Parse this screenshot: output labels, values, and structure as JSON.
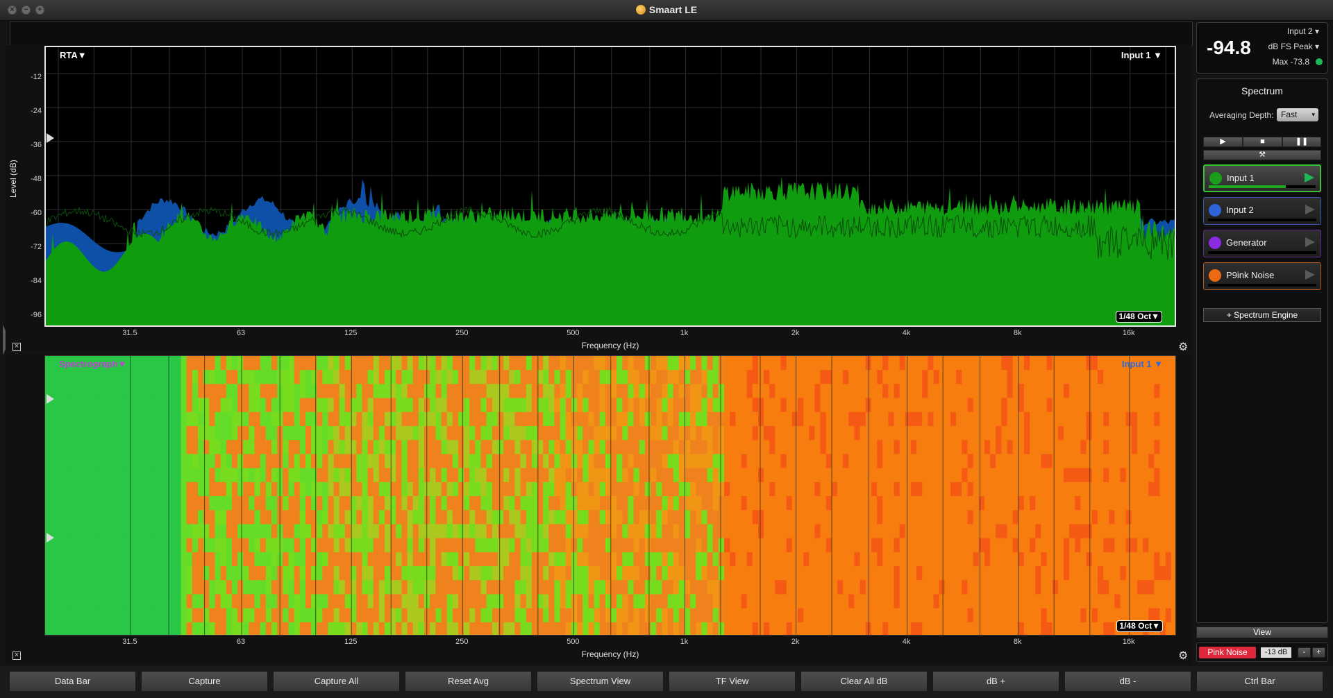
{
  "window": {
    "title": "Smaart LE"
  },
  "rta": {
    "label": "RTA▼",
    "input_label": "Input 1 ▼",
    "resolution_badge": "1/48 Oct▼",
    "y_axis_label": "Level (dB)",
    "x_axis_label": "Frequency (Hz)",
    "y_ticks": [
      "-12",
      "-24",
      "-36",
      "-48",
      "-60",
      "-72",
      "-84",
      "-96"
    ],
    "x_ticks": [
      "31.5",
      "63",
      "125",
      "250",
      "500",
      "1k",
      "2k",
      "4k",
      "8k",
      "16k"
    ]
  },
  "spectrograph": {
    "label": "Spectrograph▼",
    "input_label": "Input 1 ▼",
    "resolution_badge": "1/48 Oct▼",
    "x_axis_label": "Frequency (Hz)",
    "x_ticks": [
      "31.5",
      "63",
      "125",
      "250",
      "500",
      "1k",
      "2k",
      "4k",
      "8k",
      "16k"
    ]
  },
  "meter": {
    "value": "-94.8",
    "input_select": "Input 2",
    "mode_select": "dB FS Peak",
    "max_label": "Max -73.8",
    "status_color": "#1db954"
  },
  "spectrum_panel": {
    "title": "Spectrum",
    "averaging_label": "Averaging Depth:",
    "averaging_value": "Fast",
    "play_icon": "▶",
    "stop_icon": "■",
    "pause_icon": "❚❚",
    "tools_icon": "⚒",
    "inputs": [
      {
        "name": "Input 1",
        "color": "#1a9e1a",
        "border": "#36c436",
        "active": true,
        "level": 0.72
      },
      {
        "name": "Input 2",
        "color": "#2f64d8",
        "border": "#3b5cae",
        "active": false,
        "level": 0
      },
      {
        "name": "Generator",
        "color": "#8a2be2",
        "border": "#5c2d8c",
        "active": false,
        "level": 0
      },
      {
        "name": "P9ink Noise",
        "color": "#ee6a12",
        "border": "#b15a1c",
        "active": false,
        "level": 0
      }
    ],
    "add_engine": "+ Spectrum Engine",
    "view_button": "View"
  },
  "generator_bar": {
    "pink_noise": "Pink Noise",
    "level": "-13 dB",
    "minus": "-",
    "plus": "+"
  },
  "footer_buttons": [
    "Data Bar",
    "Capture",
    "Capture All",
    "Reset Avg",
    "Spectrum View",
    "TF View",
    "Clear All dB",
    "dB +",
    "dB -",
    "Ctrl Bar"
  ]
}
